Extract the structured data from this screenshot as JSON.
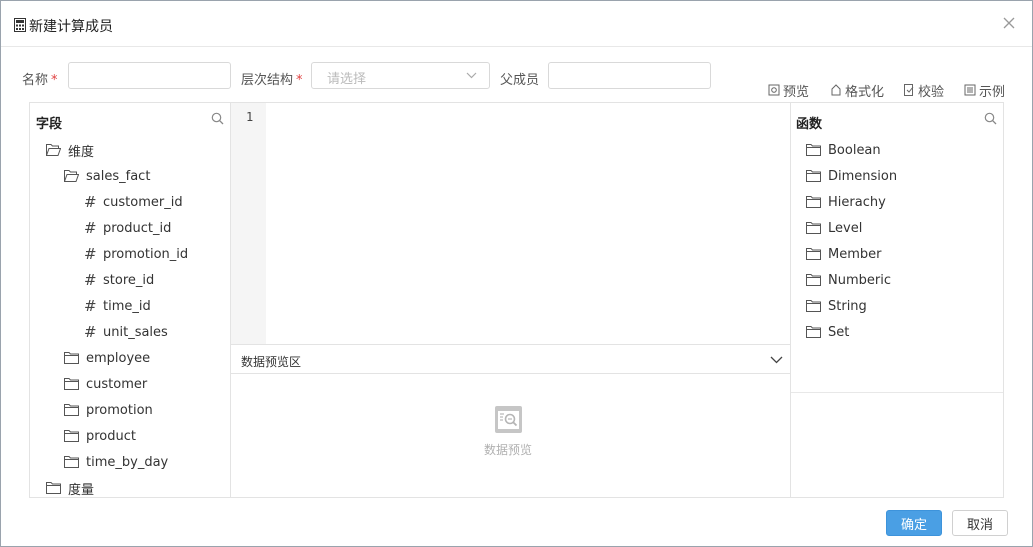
{
  "dialog": {
    "title": "新建计算成员",
    "title_icon": "calculator-icon",
    "close_icon": "close-icon"
  },
  "form": {
    "name_label": "名称",
    "name_value": "",
    "hierarchy_label": "层次结构",
    "hierarchy_placeholder": "请选择",
    "parent_label": "父成员",
    "parent_value": "",
    "required_mark": "*"
  },
  "toolbar": {
    "preview": "预览",
    "format": "格式化",
    "validate": "校验",
    "example": "示例"
  },
  "fields_panel": {
    "title": "字段",
    "tree": {
      "dimension": "维度",
      "sales_fact": "sales_fact",
      "sales_fact_fields": [
        "customer_id",
        "product_id",
        "promotion_id",
        "store_id",
        "time_id",
        "unit_sales"
      ],
      "other_tables": [
        "employee",
        "customer",
        "promotion",
        "product",
        "time_by_day"
      ],
      "measure": "度量"
    }
  },
  "editor": {
    "line_numbers": [
      "1"
    ],
    "content": ""
  },
  "preview_area": {
    "title": "数据预览区",
    "empty_text": "数据预览"
  },
  "functions_panel": {
    "title": "函数",
    "categories": [
      "Boolean",
      "Dimension",
      "Hierachy",
      "Level",
      "Member",
      "Numberic",
      "String",
      "Set"
    ]
  },
  "buttons": {
    "ok": "确定",
    "cancel": "取消"
  },
  "colors": {
    "primary": "#4a9fe4",
    "required": "#e04040",
    "border": "#e3e3e3"
  }
}
